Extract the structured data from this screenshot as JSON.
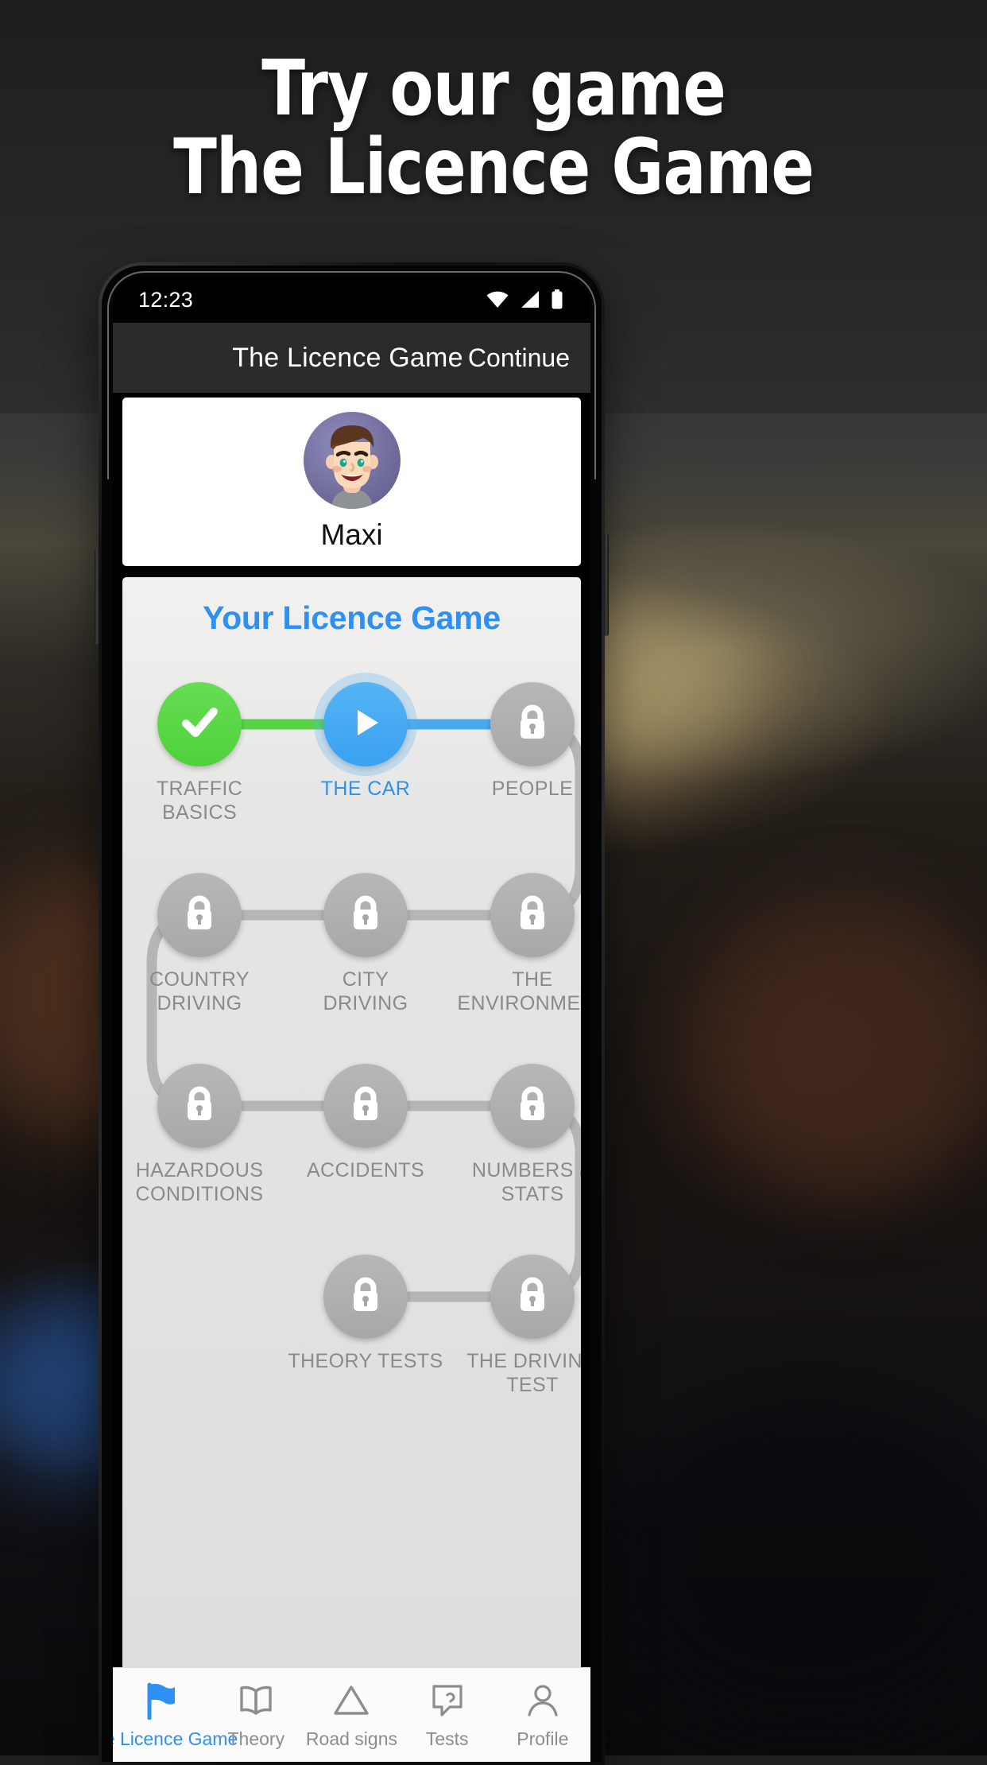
{
  "promo": {
    "headline_line1": "Try our game",
    "headline_line2": "The Licence Game"
  },
  "phone": {
    "status_bar": {
      "time": "12:23",
      "icons": [
        "wifi-icon",
        "signal-icon",
        "battery-icon"
      ]
    },
    "app_bar": {
      "title": "The Licence Game",
      "action_label": "Continue"
    },
    "profile": {
      "name": "Maxi",
      "avatar": "boy-avatar"
    },
    "map": {
      "title": "Your Licence Game",
      "nodes": [
        {
          "label": "TRAFFIC\nBASICS",
          "state": "done",
          "icon": "check-icon"
        },
        {
          "label": "THE CAR",
          "state": "current",
          "icon": "play-icon"
        },
        {
          "label": "PEOPLE",
          "state": "locked",
          "icon": "lock-icon"
        },
        {
          "label": "COUNTRY\nDRIVING",
          "state": "locked",
          "icon": "lock-icon"
        },
        {
          "label": "CITY\nDRIVING",
          "state": "locked",
          "icon": "lock-icon"
        },
        {
          "label": "THE\nENVIRONMENT",
          "state": "locked",
          "icon": "lock-icon"
        },
        {
          "label": "HAZARDOUS\nCONDITIONS",
          "state": "locked",
          "icon": "lock-icon"
        },
        {
          "label": "ACCIDENTS",
          "state": "locked",
          "icon": "lock-icon"
        },
        {
          "label": "NUMBERS &\nSTATS",
          "state": "locked",
          "icon": "lock-icon"
        },
        {
          "label": "THEORY TESTS",
          "state": "locked",
          "icon": "lock-icon"
        },
        {
          "label": "THE DRIVING\nTEST",
          "state": "locked",
          "icon": "lock-icon"
        }
      ]
    },
    "tabs": [
      {
        "label": "The Licence Game",
        "icon": "flag-icon",
        "active": true
      },
      {
        "label": "Theory",
        "icon": "book-icon",
        "active": false
      },
      {
        "label": "Road signs",
        "icon": "triangle-icon",
        "active": false
      },
      {
        "label": "Tests",
        "icon": "tests-icon",
        "active": false
      },
      {
        "label": "Profile",
        "icon": "person-icon",
        "active": false
      }
    ]
  },
  "colors": {
    "accent_blue": "#2e90f3",
    "done_green": "#4fd13c",
    "locked_gray": "#a8a8a8",
    "label_gray": "#8a8a8a",
    "appbar_bg": "#2b2b2b"
  }
}
